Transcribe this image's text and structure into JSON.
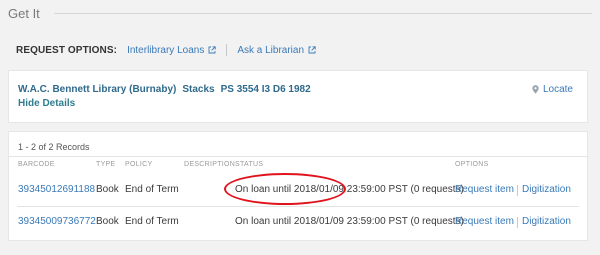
{
  "header": {
    "title": "Get It"
  },
  "request_options": {
    "label": "REQUEST OPTIONS:",
    "links": [
      {
        "label": "Interlibrary Loans"
      },
      {
        "label": "Ask a Librarian"
      }
    ]
  },
  "location": {
    "library": "W.A.C. Bennett Library (Burnaby)",
    "collection": "Stacks",
    "call_number": "PS 3554 I3 D6 1982",
    "hide_details": "Hide Details",
    "locate": "Locate"
  },
  "records": {
    "count": "1 - 2 of 2 Records",
    "columns": [
      "BARCODE",
      "TYPE",
      "POLICY",
      "DESCRIPTION",
      "STATUS",
      "OPTIONS"
    ],
    "rows": [
      {
        "barcode": "39345012691188",
        "type": "Book",
        "policy": "End of Term",
        "description": "",
        "status": "On loan until 2018/01/09 23:59:00 PST (0 requests)",
        "options": [
          "Request item",
          "Digitization"
        ]
      },
      {
        "barcode": "39345009736772",
        "type": "Book",
        "policy": "End of Term",
        "description": "",
        "status": "On loan until 2018/01/09 23:59:00 PST (0 requests)",
        "options": [
          "Request item",
          "Digitization"
        ]
      }
    ]
  },
  "annotation": {
    "color": "#e0141d",
    "shape": "ellipse"
  },
  "colors": {
    "link": "#3a7ab8",
    "location": "#2f6a8c",
    "background": "#f2f2f2"
  }
}
